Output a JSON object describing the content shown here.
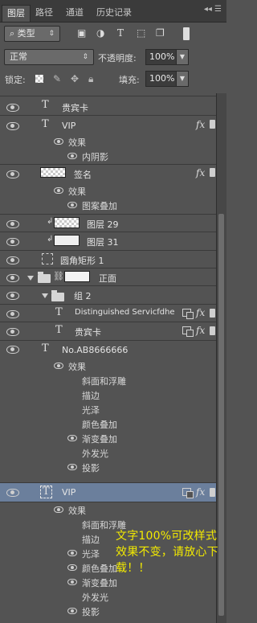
{
  "tabs": [
    "图层",
    "路径",
    "通道",
    "历史记录"
  ],
  "filter": {
    "label": "类型"
  },
  "blend": {
    "mode": "正常",
    "opacity_label": "不透明度:",
    "opacity": "100%"
  },
  "lock": {
    "label": "锁定:",
    "fill_label": "填充:",
    "fill": "100%"
  },
  "layers": {
    "l1": "贵宾卡",
    "l2": "VIP",
    "l2_effects": "效果",
    "l2_e1": "内阴影",
    "l3": "签名",
    "l3_effects": "效果",
    "l3_e1": "图案叠加",
    "l4": "图层 29",
    "l5": "图层 31",
    "l6": "圆角矩形 1",
    "l7": "正面",
    "l8": "组 2",
    "l9": "Distinguished Servicfdhe",
    "l10": "贵宾卡",
    "l11": "No.AB8666666",
    "l11_effects": "效果",
    "l11_e1": "斜面和浮雕",
    "l11_e2": "描边",
    "l11_e3": "光泽",
    "l11_e4": "颜色叠加",
    "l11_e5": "渐变叠加",
    "l11_e6": "外发光",
    "l11_e7": "投影",
    "l12": "VIP",
    "l12_effects": "效果",
    "l12_e1": "斜面和浮雕",
    "l12_e2": "描边",
    "l12_e3": "光泽",
    "l12_e4": "颜色叠加",
    "l12_e5": "渐变叠加",
    "l12_e6": "外发光",
    "l12_e7": "投影"
  },
  "fx_label": "fx",
  "text_icon": "T",
  "promo_text": "文字100%可改样式效果不变，请放心下载！！",
  "colors": {
    "selected_row": "#6b7f9c",
    "promo": "#f3ea00"
  }
}
